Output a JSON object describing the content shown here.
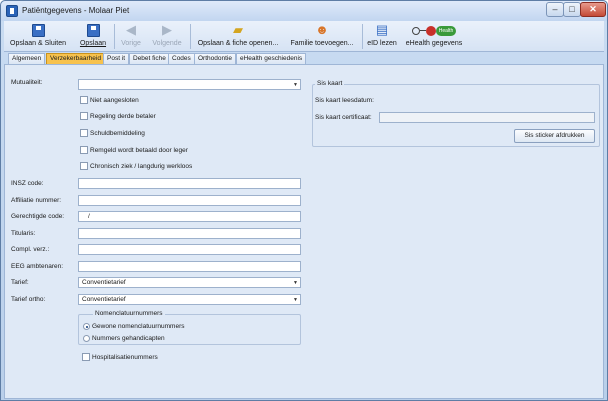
{
  "window": {
    "title": "Patiëntgegevens - Molaar Piet",
    "controls": {
      "minimize": "–",
      "maximize": "□",
      "close": "✕"
    }
  },
  "toolbar": {
    "save_close": "Opslaan & Sluiten",
    "save": "Opslaan",
    "previous": "Vorige",
    "next": "Volgende",
    "save_open_file": "Opslaan & fiche openen...",
    "add_family": "Familie toevoegen...",
    "read_eid": "eID lezen",
    "ehealth_data": "eHealth gegevens",
    "ehealth_badge": "Health"
  },
  "tabs": [
    "Algemeen",
    "Verzekerbaarheid",
    "Post it",
    "Debet fiche",
    "Codes",
    "Orthodontie",
    "eHealth geschiedenis"
  ],
  "form": {
    "mutualiteit_label": "Mutualiteit:",
    "mutualiteit_value": "",
    "checkboxes": [
      "Niet aangesloten",
      "Regeling derde betaler",
      "Schuldbemiddeling",
      "Remgeld wordt betaald door leger",
      "Chronisch ziek / langdurig werkloos"
    ],
    "insz_label": "INSZ code:",
    "insz_value": "",
    "affiliatie_label": "Affiliatie nummer:",
    "affiliatie_value": "",
    "gerechtigde_label": "Gerechtigde code:",
    "gerechtigde_value": "/",
    "titularis_label": "Titularis:",
    "titularis_value": "",
    "compl_label": "Compl. verz.:",
    "compl_value": "",
    "eeg_label": "EEG ambtenaren:",
    "eeg_value": "",
    "tarief_label": "Tarief:",
    "tarief_value": "Conventietarief",
    "tarief_ortho_label": "Tarief ortho:",
    "tarief_ortho_value": "Conventietarief",
    "nomenclatuur_title": "Nomenclatuurnummers",
    "nomenclatuur_options": [
      "Gewone nomenclatuurnummers",
      "Nummers gehandicapten"
    ],
    "hospitalisatie_label": "Hospitalisatienummers"
  },
  "sis": {
    "title": "Sis kaart",
    "leesdatum_label": "Sis kaart leesdatum:",
    "leesdatum_value": "",
    "certificaat_label": "Sis kaart certificaat:",
    "certificaat_value": "",
    "print_button": "Sis sticker afdrukken"
  }
}
